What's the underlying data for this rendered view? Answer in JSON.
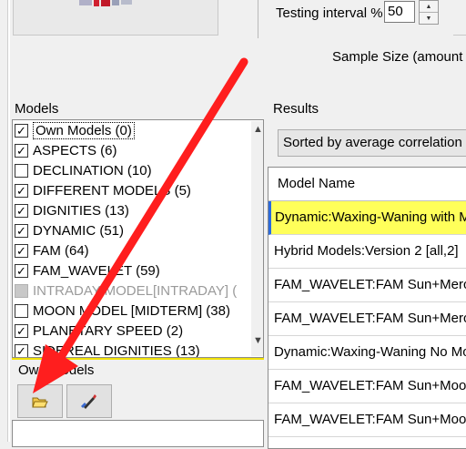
{
  "testing": {
    "label": "Testing interval %",
    "value": "50"
  },
  "sample": {
    "label": "Sample Size (amount t"
  },
  "models": {
    "title": "Models",
    "items": [
      {
        "label": "Own Models (0)",
        "checked": true,
        "enabled": true
      },
      {
        "label": "ASPECTS (6)",
        "checked": true,
        "enabled": true
      },
      {
        "label": "DECLINATION (10)",
        "checked": false,
        "enabled": true
      },
      {
        "label": "DIFFERENT MODELS (5)",
        "checked": true,
        "enabled": true
      },
      {
        "label": "DIGNITIES (13)",
        "checked": true,
        "enabled": true
      },
      {
        "label": "DYNAMIC (51)",
        "checked": true,
        "enabled": true
      },
      {
        "label": "FAM (64)",
        "checked": true,
        "enabled": true
      },
      {
        "label": "FAM_WAVELET (59)",
        "checked": true,
        "enabled": true
      },
      {
        "label": "INTRADAY MODEL[INTRADAY] (",
        "checked": false,
        "enabled": false
      },
      {
        "label": "MOON MODEL [MIDTERM] (38)",
        "checked": false,
        "enabled": true
      },
      {
        "label": "PLANETARY SPEED (2)",
        "checked": true,
        "enabled": true
      },
      {
        "label": "SIDEREAL DIGNITIES (13)",
        "checked": true,
        "enabled": true
      }
    ]
  },
  "own_models": {
    "title": "Own Models"
  },
  "results": {
    "title": "Results",
    "sort_label": "Sorted by average correlation",
    "column_header": "Model Name",
    "rows": [
      "Dynamic:Waxing-Waning with Mo",
      "Hybrid Models:Version 2 [all,2]",
      "FAM_WAVELET:FAM Sun+Merc",
      "FAM_WAVELET:FAM Sun+Merc",
      "Dynamic:Waxing-Waning No Moo",
      "FAM_WAVELET:FAM Sun+Moo",
      "FAM_WAVELET:FAM Sun+Moo"
    ]
  },
  "icons": {
    "open": "open-folder-icon",
    "edit": "edit-icon",
    "arrow": "red-arrow-annotation"
  },
  "colors": {
    "arrow": "#ff1e1e",
    "selected_row": "#ffff5a",
    "focus_line": "#f0e000"
  }
}
